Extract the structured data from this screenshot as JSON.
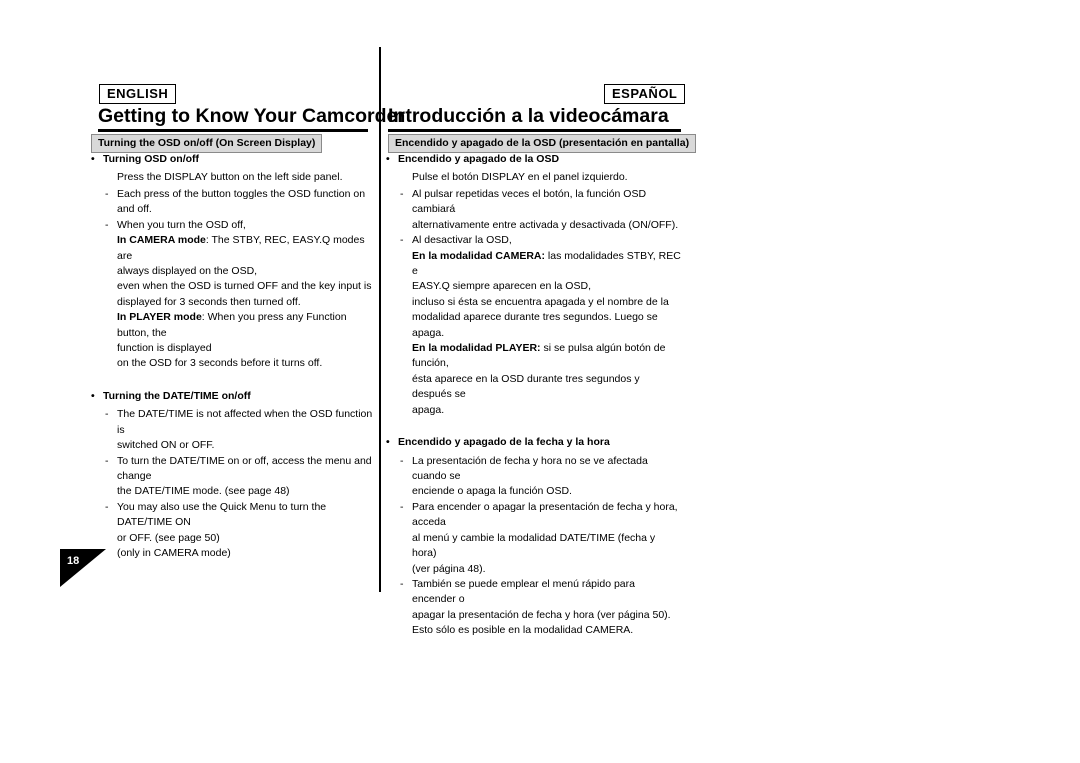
{
  "page": {
    "number": "18"
  },
  "left": {
    "language_tag": "ENGLISH",
    "title": "Getting to Know Your Camcorder",
    "section": "Turning the OSD on/off (On Screen Display)",
    "blocks": [
      {
        "heading": "Turning OSD on/off",
        "lines": [
          {
            "type": "para",
            "text": "Press the DISPLAY button on the left side panel."
          },
          {
            "type": "dash",
            "text": "Each press of the button toggles the OSD function on and off."
          },
          {
            "type": "dash",
            "text": "When you turn the OSD off,"
          },
          {
            "type": "cont",
            "bold": "In CAMERA mode",
            "text": ": The STBY, REC, EASY.Q modes are"
          },
          {
            "type": "cont",
            "text": "always displayed on the OSD,"
          },
          {
            "type": "cont",
            "text": "even when the OSD is turned OFF and the key input is"
          },
          {
            "type": "cont",
            "text": "displayed for 3 seconds then turned off."
          },
          {
            "type": "cont",
            "bold": "In PLAYER mode",
            "text": ": When you press any Function button, the"
          },
          {
            "type": "cont",
            "text": "function is displayed"
          },
          {
            "type": "cont",
            "text": "on the OSD for 3 seconds before it turns off."
          }
        ]
      },
      {
        "heading": "Turning the DATE/TIME on/off",
        "lines": [
          {
            "type": "dash",
            "text": "The DATE/TIME is not affected when the OSD function is"
          },
          {
            "type": "cont",
            "text": "switched ON or OFF."
          },
          {
            "type": "dash",
            "text": "To turn the DATE/TIME on or off, access the menu and change"
          },
          {
            "type": "cont",
            "text": "the DATE/TIME mode. (see page 48)"
          },
          {
            "type": "dash",
            "text": "You may also use the Quick Menu to turn the DATE/TIME ON"
          },
          {
            "type": "cont",
            "text": "or OFF. (see page 50)"
          },
          {
            "type": "cont",
            "text": "(only in CAMERA mode)"
          }
        ]
      }
    ]
  },
  "right": {
    "language_tag": "ESPAÑOL",
    "title": "Introducción a la videocámara",
    "section": "Encendido y apagado de la OSD (presentación en pantalla)",
    "blocks": [
      {
        "heading": "Encendido y apagado de la OSD",
        "lines": [
          {
            "type": "para",
            "text": "Pulse el botón DISPLAY en el panel izquierdo."
          },
          {
            "type": "dash",
            "text": "Al pulsar repetidas veces el botón, la función OSD cambiará"
          },
          {
            "type": "cont",
            "text": "alternativamente entre activada y desactivada (ON/OFF)."
          },
          {
            "type": "dash",
            "text": "Al desactivar la OSD,"
          },
          {
            "type": "cont",
            "bold": "En la modalidad CAMERA:",
            "text": " las modalidades STBY, REC e"
          },
          {
            "type": "cont",
            "text": "EASY.Q siempre aparecen en la OSD,"
          },
          {
            "type": "cont",
            "text": "incluso si ésta se encuentra apagada y el nombre de la"
          },
          {
            "type": "cont",
            "text": "modalidad aparece durante tres segundos. Luego se apaga."
          },
          {
            "type": "cont",
            "bold": "En la modalidad PLAYER:",
            "text": " si se pulsa algún botón de función,"
          },
          {
            "type": "cont",
            "text": "ésta aparece en la OSD durante tres segundos y después se"
          },
          {
            "type": "cont",
            "text": "apaga."
          }
        ]
      },
      {
        "heading": "Encendido y apagado de la fecha y la hora",
        "lines": [
          {
            "type": "dash",
            "text": "La presentación de fecha y hora no se ve afectada cuando se"
          },
          {
            "type": "cont",
            "text": "enciende o apaga la función OSD."
          },
          {
            "type": "dash",
            "text": "Para encender o apagar la presentación de fecha y hora, acceda"
          },
          {
            "type": "cont",
            "text": "al menú y cambie la modalidad DATE/TIME (fecha y hora)"
          },
          {
            "type": "cont",
            "text": "(ver página 48)."
          },
          {
            "type": "dash",
            "text": "También se puede emplear el menú rápido para encender o"
          },
          {
            "type": "cont",
            "text": "apagar la presentación de fecha y hora (ver página 50)."
          },
          {
            "type": "cont",
            "text": "Esto sólo es posible en la modalidad CAMERA."
          }
        ]
      }
    ]
  }
}
